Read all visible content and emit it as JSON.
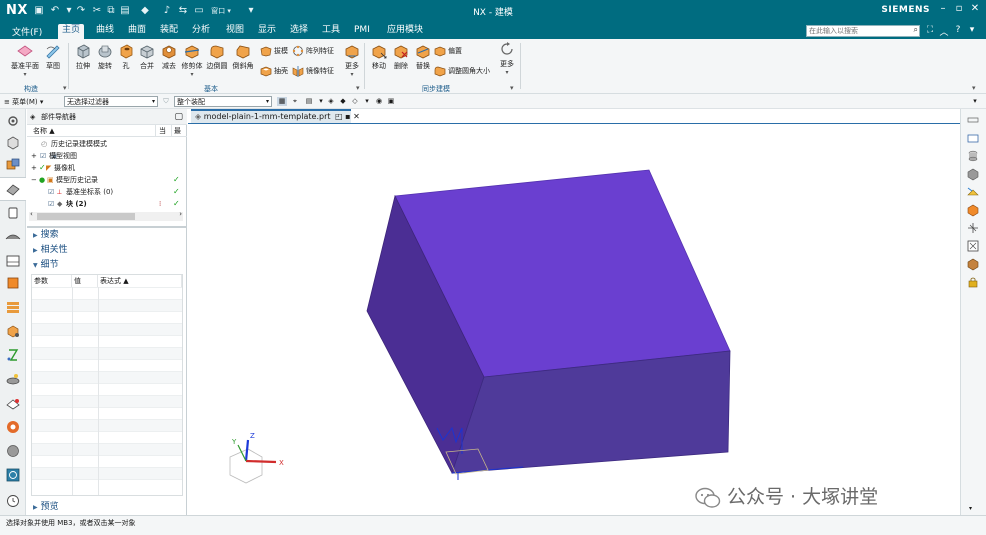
{
  "titlebar": {
    "logo": "NX",
    "window_title": "NX - 建模",
    "brand": "SIEMENS",
    "window_controls": [
      "–",
      "▫",
      "✕"
    ]
  },
  "menubar": {
    "file": "文件(F)",
    "tabs": [
      "主页",
      "曲线",
      "曲面",
      "装配",
      "分析",
      "视图",
      "显示",
      "选择",
      "工具",
      "PMI",
      "应用模块"
    ],
    "active_tab": "主页",
    "search_placeholder": "在此输入以搜索"
  },
  "ribbon": {
    "construct": {
      "label": "构造",
      "datum_plane": "基准平面",
      "sketch": "草图"
    },
    "basic": {
      "label": "基本",
      "items": [
        "拉伸",
        "旋转",
        "孔",
        "合并",
        "减去",
        "修剪体",
        "边倒圆",
        "倒斜角"
      ],
      "draft": "拔模",
      "pattern": "阵列特征",
      "shell": "抽壳",
      "mirror": "镜像特征",
      "more": "更多"
    },
    "sync": {
      "label": "同步建模",
      "move": "移动",
      "delete": "删除",
      "replace": "替换",
      "offset": "偏置",
      "resize_blend": "调整圆角大小",
      "more": "更多"
    }
  },
  "selbar": {
    "menu": "菜单(M)",
    "filter": "无选择过滤器",
    "scope": "整个装配"
  },
  "navigator": {
    "title": "部件导航器",
    "col_name": "名称",
    "col_current": "当",
    "col_latest": "最",
    "rows": [
      {
        "label": "历史记录建模模式"
      },
      {
        "label": "模型视图"
      },
      {
        "label": "摄像机"
      },
      {
        "label": "模型历史记录"
      },
      {
        "label": "基准坐标系 (0)"
      },
      {
        "label": "块 (2)"
      }
    ],
    "sections": {
      "search": "搜索",
      "relations": "相关性",
      "details": "细节",
      "preview": "预览"
    },
    "details_cols": [
      "参数",
      "值",
      "表达式"
    ]
  },
  "document": {
    "tab": "model-plain-1-mm-template.prt"
  },
  "viewport": {
    "triad_labels": [
      "Y",
      "Z",
      "X"
    ],
    "body_color": "#6a3fd0"
  },
  "status": {
    "text": "选择对象并使用 MB3，或者双击某一对象"
  },
  "watermark": {
    "text": "公众号 · 大塚讲堂"
  },
  "colors": {
    "titlebar": "#006c80",
    "accent": "#1a5b8a",
    "check": "#19a11c"
  }
}
